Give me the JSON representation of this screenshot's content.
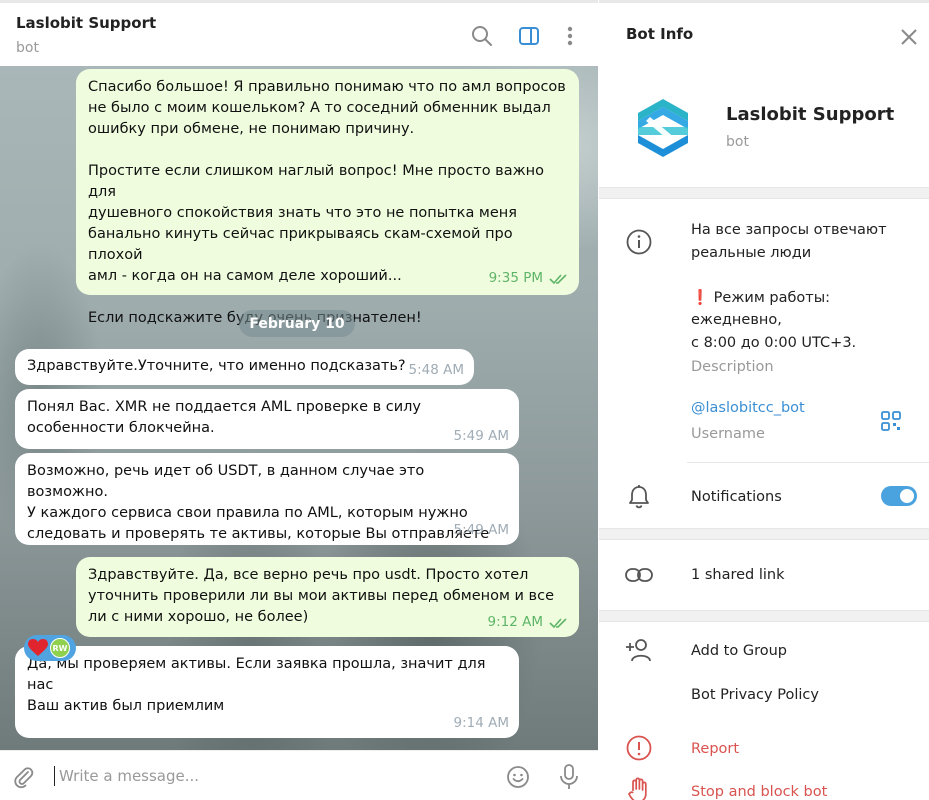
{
  "chat": {
    "title": "Laslobit Support",
    "status": "bot",
    "date_separator": "February 10",
    "messages": [
      {
        "direction": "out",
        "text": "Спасибо большое! Я правильно понимаю что по амл вопросов\nне было с моим кошельком? А то соседний обменник выдал\nошибку при обмене, не понимаю причину.\n\nПростите если слишком наглый вопрос! Мне просто важно для\nдушевного спокойствия знать что это не попытка меня\nбанально кинуть сейчас прикрываясь скам-схемой про плохой\nамл - когда он на самом деле хороший...\n\nЕсли подскажите буду очень признателен!",
        "time": "9:35 PM"
      },
      {
        "direction": "in",
        "text": "Здравствуйте.Уточните, что именно подсказать?",
        "time": "5:48 AM"
      },
      {
        "direction": "in",
        "text": "Понял Вас. XMR не поддается AML проверке в силу\nособенности блокчейна.",
        "time": "5:49 AM"
      },
      {
        "direction": "in",
        "text": "Возможно, речь идет об USDT, в данном случае это возможно.\nУ каждого сервиса свои правила по AML, которым нужно\nследовать и проверять те активы, которые Вы отправляете",
        "time": "5:49 AM"
      },
      {
        "direction": "out",
        "text": "Здравствуйте. Да, все верно речь про usdt. Просто хотел\nуточнить проверили ли вы мои активы перед обменом и все\nли с ними хорошо, не более)",
        "time": "9:12 AM"
      },
      {
        "direction": "in",
        "text": "Да, мы проверяем активы. Если заявка прошла, значит для нас\nВаш актив был приемлим",
        "time": "9:14 AM"
      }
    ],
    "reaction": {
      "emoji": "❤️",
      "avatar_initials": "RW"
    },
    "composer": {
      "placeholder": "Write a message..."
    },
    "colors": {
      "outgoing": "#effdde",
      "incoming": "#ffffff",
      "accent": "#4aa3df"
    }
  },
  "panel": {
    "title": "Bot Info",
    "name": "Laslobit Support",
    "status": "bot",
    "description_lines": [
      "На все запросы отвечают",
      "реальные люди",
      "",
      "❗ Режим работы:",
      "ежедневно,",
      "с 8:00 до 0:00 UTC+3."
    ],
    "description_label": "Description",
    "username": "@laslobitcc_bot",
    "username_label": "Username",
    "notifications_label": "Notifications",
    "notifications_on": true,
    "shared_link": "1 shared link",
    "add_to_group": "Add to Group",
    "privacy_policy": "Bot Privacy Policy",
    "report": "Report",
    "stop_block": "Stop and block bot"
  }
}
